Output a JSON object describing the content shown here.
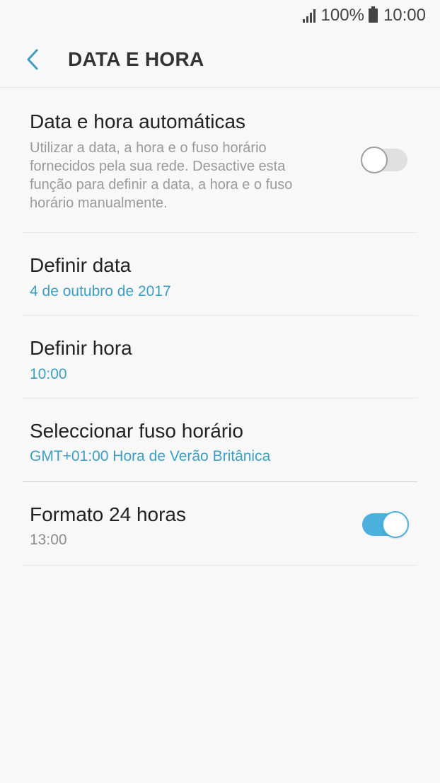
{
  "status_bar": {
    "battery": "100%",
    "time": "10:00"
  },
  "header": {
    "title": "DATA E HORA",
    "back_icon": "chevron-left-icon"
  },
  "colors": {
    "accent": "#3e9ec2",
    "toggle_on": "#4bb0de",
    "toggle_off": "#e0e0e0",
    "background": "#f8f8f8"
  },
  "settings": {
    "auto": {
      "title": "Data e hora automáticas",
      "description": "Utilizar a data, a hora e o fuso horário fornecidos pela sua rede. Desactive esta função para definir a data, a hora e o fuso horário manualmente.",
      "toggle_state": "off"
    },
    "date": {
      "title": "Definir data",
      "value": "4 de outubro de 2017"
    },
    "time": {
      "title": "Definir hora",
      "value": "10:00"
    },
    "timezone": {
      "title": "Seleccionar fuso horário",
      "value": "GMT+01:00 Hora de Verão Britânica"
    },
    "format24": {
      "title": "Formato 24 horas",
      "value": "13:00",
      "toggle_state": "on"
    }
  }
}
